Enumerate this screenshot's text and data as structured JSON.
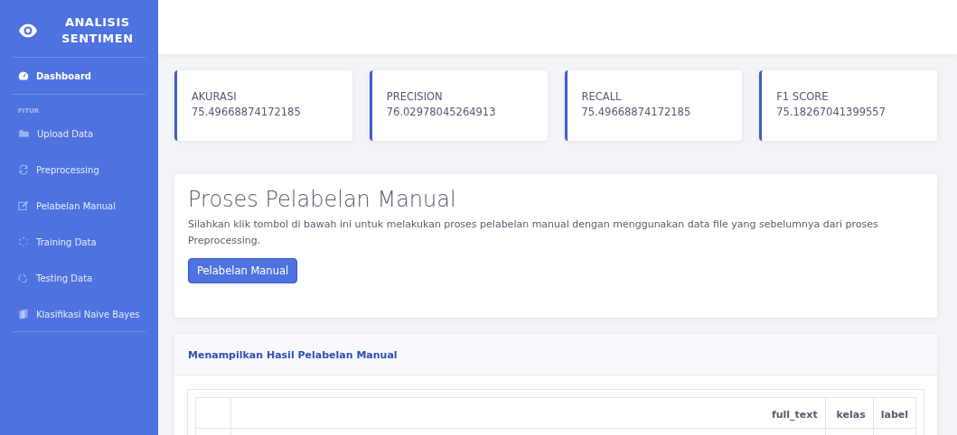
{
  "brand": {
    "line_1": "ANALISIS",
    "line_2": "SENTIMEN"
  },
  "sidebar": {
    "items": [
      {
        "label": "Dashboard",
        "selected": true
      }
    ],
    "section_heading": "FITUR",
    "feature_items": [
      {
        "label": "Upload Data",
        "selected": false
      },
      {
        "label": "Preprocessing",
        "selected": false
      },
      {
        "label": "Pelabelan Manual",
        "selected": false
      },
      {
        "label": "Training Data",
        "selected": false
      },
      {
        "label": "Testing Data",
        "selected": false
      },
      {
        "label": "Klasifikasi Naive Bayes",
        "selected": false
      }
    ]
  },
  "metrics": [
    {
      "label": "AKURASI",
      "value": "75.49668874172185"
    },
    {
      "label": "PRECISION",
      "value": "76.02978045264913"
    },
    {
      "label": "RECALL",
      "value": "75.49668874172185"
    },
    {
      "label": "F1 SCORE",
      "value": "75.18267041399557"
    }
  ],
  "process_card": {
    "title": "Proses Pelabelan Manual",
    "description": "Silahkan klik tombol di bawah ini untuk melakukan proses pelabelan manual dengan menggunakan data file yang sebelumnya dari proses Preprocessing.",
    "button": "Pelabelan Manual"
  },
  "result_card": {
    "title": "Menampilkan Hasil Pelabelan Manual",
    "table": {
      "columns": [
        "full_text",
        "kelas",
        "label"
      ]
    }
  }
}
